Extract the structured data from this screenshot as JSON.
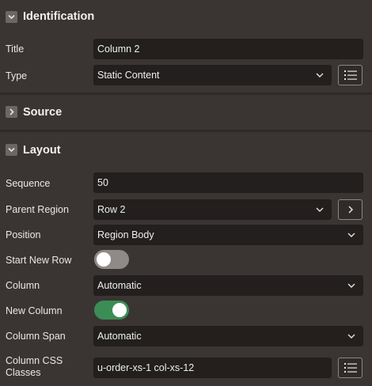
{
  "sections": {
    "identification": "Identification",
    "source": "Source",
    "layout": "Layout"
  },
  "identification": {
    "title_label": "Title",
    "title_value": "Column 2",
    "type_label": "Type",
    "type_value": "Static Content"
  },
  "layout": {
    "sequence_label": "Sequence",
    "sequence_value": "50",
    "parent_region_label": "Parent Region",
    "parent_region_value": "Row 2",
    "position_label": "Position",
    "position_value": "Region Body",
    "start_new_row_label": "Start New Row",
    "start_new_row_on": false,
    "column_label": "Column",
    "column_value": "Automatic",
    "new_column_label": "New Column",
    "new_column_on": true,
    "column_span_label": "Column Span",
    "column_span_value": "Automatic",
    "column_css_label_line1": "Column CSS",
    "column_css_label_line2": "Classes",
    "column_css_value": "u-order-xs-1 col-xs-12"
  },
  "icons": {
    "section_expanded": "chevron-down-icon",
    "section_collapsed": "chevron-right-icon",
    "list": "list-icon",
    "go": "chevron-right-icon"
  },
  "colors": {
    "background": "#3a3532",
    "field": "#221f1e",
    "toggle_on": "#3b8d55",
    "toggle_off": "#8f8a87"
  }
}
